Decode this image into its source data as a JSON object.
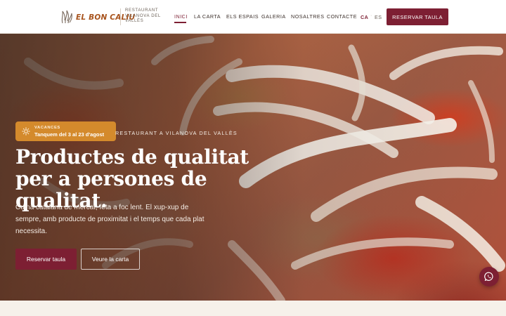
{
  "brand": {
    "name": "EL BON CALIU",
    "tagline": "RESTAURANT VILANOVA DEL VALLÈS"
  },
  "nav": {
    "items": [
      {
        "label": "INICI",
        "active": true
      },
      {
        "label": "LA CARTA",
        "active": false
      },
      {
        "label": "ELS ESPAIS",
        "active": false
      },
      {
        "label": "GALERIA",
        "active": false
      },
      {
        "label": "NOSALTRES",
        "active": false
      },
      {
        "label": "CONTACTE",
        "active": false
      }
    ],
    "languages": [
      {
        "code": "CA",
        "active": true
      },
      {
        "code": "ES",
        "active": false
      }
    ],
    "language_separator": "·",
    "cta_label": "RESERVAR TAULA"
  },
  "hero": {
    "badge": {
      "title": "VACANCES",
      "text": "Tanquem del 3 al 23 d'agost",
      "icon": "sun-icon"
    },
    "kicker": "RESTAURANT A VILANOVA DEL VALLÈS",
    "headline": "Productes de qualitat per a persones de qualitat.",
    "lead": "Cuina catalana de mercat, feta a foc lent. El xup-xup de sempre, amb producte de proximitat i el temps que cada plat necessita.",
    "primary_button": "Reservar taula",
    "secondary_button": "Veure la carta"
  },
  "floating": {
    "whatsapp_icon": "whatsapp-icon"
  },
  "colors": {
    "brand_burgundy": "#7d1f33",
    "logo_orange": "#a8541e",
    "badge_amber": "#d48a2c"
  }
}
